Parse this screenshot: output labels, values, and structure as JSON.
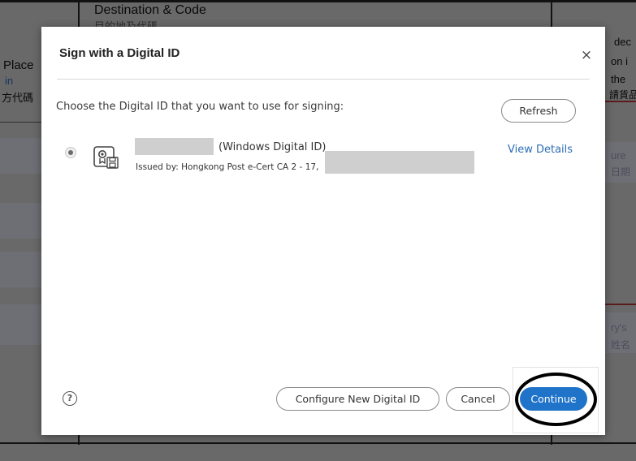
{
  "background": {
    "header_text": "Destination & Code",
    "header_cjk": "目的地及代碼",
    "left_place": "Place",
    "left_in": "in",
    "left_cjk": "方代碼",
    "right_text_1": "dec",
    "right_text_2": "on i",
    "right_text_3": "the",
    "right_cjk_1": "請貨品",
    "right_text_4": "ure",
    "right_cjk_2": "日期",
    "right_text_5": "ry's",
    "right_cjk_3": "姓名"
  },
  "dialog": {
    "title": "Sign with a Digital ID",
    "close_glyph": "×",
    "prompt": "Choose the Digital ID that you want to use for signing:",
    "refresh_label": "Refresh",
    "digital_id": {
      "name_suffix": "(Windows Digital ID)",
      "issuer": "Issued by: Hongkong Post e-Cert CA 2 - 17,",
      "view_details_label": "View Details",
      "selected": true
    },
    "help_glyph": "?",
    "configure_label": "Configure New Digital ID",
    "cancel_label": "Cancel",
    "continue_label": "Continue"
  },
  "colors": {
    "primary": "#1f73c9",
    "link": "#2d6db5",
    "highlight_ring": "#000000"
  }
}
